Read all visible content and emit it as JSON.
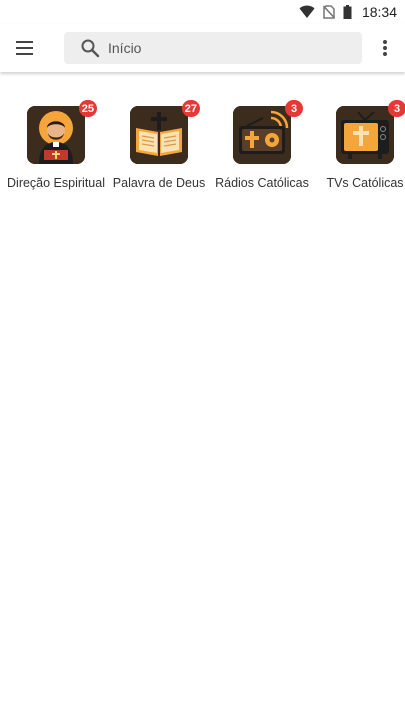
{
  "status_bar": {
    "time": "18:34",
    "icons": [
      "wifi-icon",
      "no-sim-icon",
      "battery-icon"
    ]
  },
  "app_bar": {
    "menu_icon": "hamburger-menu-icon",
    "search": {
      "placeholder": "Início",
      "value": ""
    },
    "more_icon": "more-vert-icon"
  },
  "categories": [
    {
      "label": "Direção Espiritual",
      "badge": "25",
      "icon": "priest-icon"
    },
    {
      "label": "Palavra de Deus",
      "badge": "27",
      "icon": "bible-icon"
    },
    {
      "label": "Rádios Católicas",
      "badge": "3",
      "icon": "radio-icon"
    },
    {
      "label": "TVs Católicas",
      "badge": "3",
      "icon": "tv-icon"
    }
  ],
  "colors": {
    "badge": "#e53935",
    "tile_background": "#3b2c1d",
    "accent_orange": "#f5a63a"
  }
}
